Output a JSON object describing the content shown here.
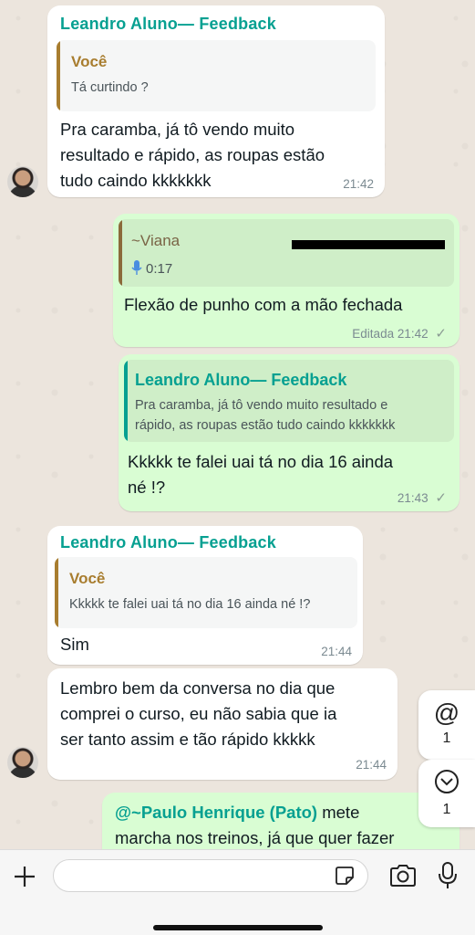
{
  "messages": [
    {
      "sender": "Leandro Aluno— Feedback",
      "quote_name": "Você",
      "quote_text": "Tá curtindo ?",
      "line1": "Pra caramba, já tô vendo muito",
      "line2": "resultado e rápido, as roupas estão",
      "line3": "tudo caindo kkkkkkk",
      "time": "21:42"
    },
    {
      "quote_name": "~Viana",
      "voice_duration": "0:17",
      "text": "Flexão de punho com a mão fechada",
      "edited_label": "Editada",
      "time": "21:42"
    },
    {
      "quote_name": "Leandro Aluno— Feedback",
      "quote_line1": "Pra caramba, já tô vendo muito resultado e",
      "quote_line2": "rápido, as roupas estão tudo caindo kkkkkkk",
      "line1": "Kkkkk te falei uai tá no dia 16 ainda",
      "line2": "né !?",
      "time": "21:43"
    },
    {
      "sender": "Leandro Aluno— Feedback",
      "quote_name": "Você",
      "quote_text": "Kkkkk te falei uai tá no dia 16 ainda né !?",
      "text": "Sim",
      "time": "21:44"
    },
    {
      "line1": "Lembro bem da conversa no dia que",
      "line2": "comprei o curso, eu não sabia que ia",
      "line3": "ser tanto assim e tão rápido kkkkk",
      "time": "21:44"
    },
    {
      "mention": "@~Paulo Henrique (Pato)",
      "line1_rest": " mete",
      "line2": "marcha nos treinos, já que quer fazer"
    }
  ],
  "side": {
    "mentions_icon": "@",
    "mentions_count": "1",
    "scroll_count": "1"
  },
  "icons": [
    "plus-icon",
    "sticker-icon",
    "camera-icon",
    "microphone-icon",
    "check-icon",
    "chevron-down-icon",
    "mic-small-icon"
  ],
  "colors": {
    "sender_teal": "#06a091",
    "you_brown": "#a87d2f",
    "viana_brown": "#8b6a3a",
    "outgoing_bg": "#d9fdd3",
    "incoming_bg": "#ffffff"
  }
}
